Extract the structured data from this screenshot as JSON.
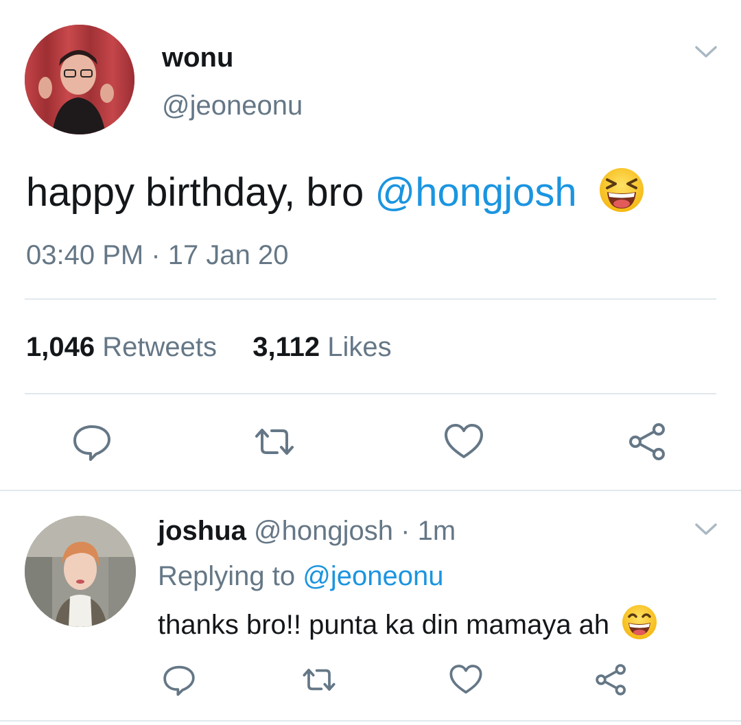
{
  "main_tweet": {
    "author": {
      "display_name": "wonu",
      "handle": "@jeoneonu"
    },
    "text_plain": "happy birthday, bro ",
    "text_mention": "@hongjosh",
    "emoji": "laughing-face",
    "time": "03:40 PM",
    "separator": "·",
    "date": "17 Jan 20",
    "stats": {
      "retweets_count": "1,046",
      "retweets_label": "Retweets",
      "likes_count": "3,112",
      "likes_label": "Likes"
    },
    "actions": [
      "reply-icon",
      "retweet-icon",
      "like-icon",
      "share-icon"
    ]
  },
  "reply_tweet": {
    "author": {
      "display_name": "joshua",
      "handle": "@hongjosh",
      "separator": "·",
      "relative_time": "1m"
    },
    "replying_to_label": "Replying to",
    "replying_to_handle": "@jeoneonu",
    "text": "thanks bro!! punta ka din mamaya ah",
    "emoji": "grinning-face",
    "actions": [
      "reply-icon",
      "retweet-icon",
      "like-icon",
      "share-icon"
    ]
  },
  "colors": {
    "text": "#14171a",
    "secondary": "#657786",
    "link": "#1b95e0",
    "divider": "#e1e8ed",
    "chevron": "#aab8c2"
  }
}
